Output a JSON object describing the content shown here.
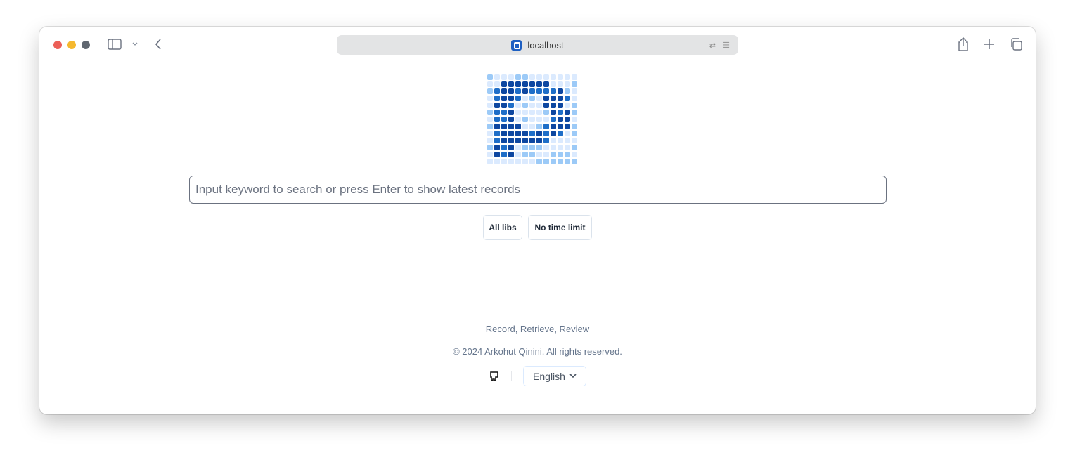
{
  "browser": {
    "address": "localhost",
    "icons": [
      "sidebar-icon",
      "chevron-down-icon",
      "back-icon",
      "translate-icon",
      "reader-icon",
      "share-icon",
      "new-tab-icon",
      "tabs-icon"
    ],
    "traffic_lights": [
      "#ec5f57",
      "#f5b82e",
      "#606770"
    ]
  },
  "logo": {
    "colors": [
      "#dbeafe",
      "#9ccaf7",
      "#1e6ec8",
      "#0d47a1"
    ]
  },
  "search": {
    "placeholder": "Input keyword to search or press Enter to show latest records",
    "value": ""
  },
  "filters": {
    "libs": "All libs",
    "time": "No time limit"
  },
  "footer": {
    "tagline": "Record, Retrieve, Review",
    "copyright": "© 2024 Arkohut Qinini. All rights reserved.",
    "language": "English"
  }
}
